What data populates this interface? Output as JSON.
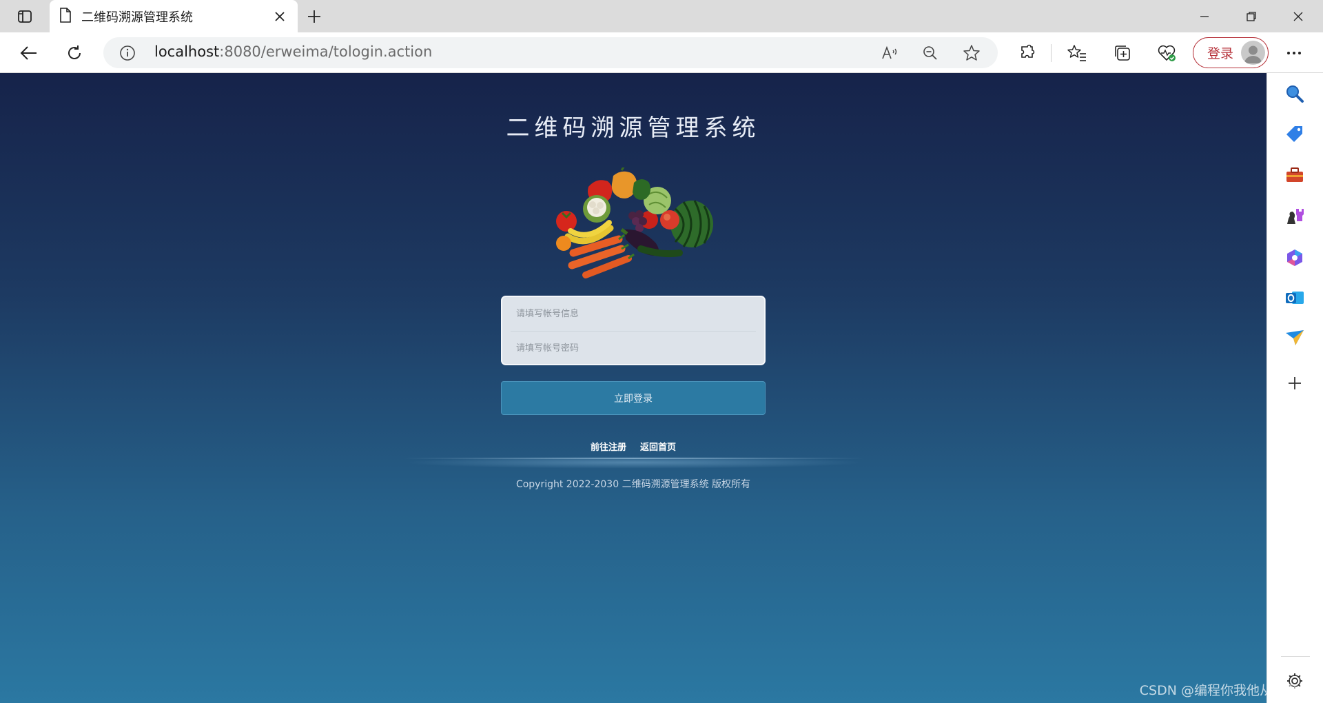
{
  "browser": {
    "tab_title": "二维码溯源管理系统",
    "url_host": "localhost",
    "url_path": ":8080/erweima/tologin.action",
    "signin_label": "登录"
  },
  "page": {
    "system_title": "二维码溯源管理系统",
    "account_placeholder": "请填写帐号信息",
    "password_placeholder": "请填写帐号密码",
    "login_button": "立即登录",
    "register_link": "前往注册",
    "home_link": "返回首页",
    "copyright": "Copyright 2022-2030 二维码溯源管理系统 版权所有"
  },
  "watermark": "CSDN @编程你我他从零开始",
  "colors": {
    "page_top": "#16234a",
    "page_bottom": "#2b78a2",
    "login_button": "#2c7aa3",
    "signin_accent": "#b6323a"
  },
  "icons": {
    "toolbar": [
      "back-icon",
      "refresh-icon",
      "info-icon",
      "read-aloud-icon",
      "zoom-out-icon",
      "favorite-star-icon",
      "extensions-icon",
      "favorites-icon",
      "collections-icon",
      "browser-essentials-icon",
      "more-icon"
    ],
    "sidebar": [
      "search-icon",
      "shopping-tag-icon",
      "tools-icon",
      "games-icon",
      "copilot-icon",
      "outlook-icon",
      "send-icon",
      "add-icon",
      "settings-icon"
    ]
  }
}
